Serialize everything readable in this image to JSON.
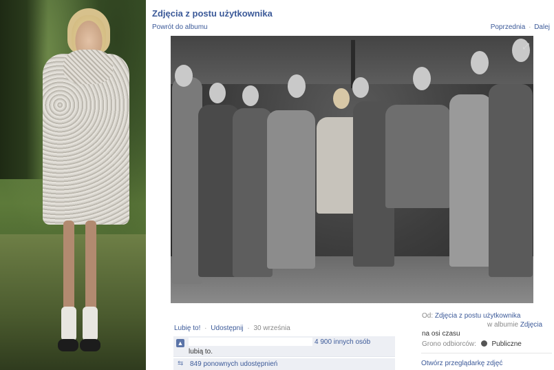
{
  "header": {
    "title": "Zdjęcia z postu użytkownika",
    "back_link": "Powrót do albumu",
    "prev_link": "Poprzednia",
    "next_link": "Dalej",
    "nav_separator": "·"
  },
  "actions": {
    "like": "Lubię to!",
    "share": "Udostępnij",
    "separator": "·",
    "date": "30 września"
  },
  "likes": {
    "count_text": "4 900 innych osób",
    "tail_text": "lubią to."
  },
  "shares": {
    "text": "849 ponownych udostępnień"
  },
  "meta": {
    "from_label": "Od:",
    "from_link": "Zdjęcia z postu użytkownika",
    "album_prefix": "w albumie",
    "album_link": "Zdjęcia",
    "album_tail": "na osi czasu",
    "audience_label": "Grono odbiorców:",
    "audience_value": "Publiczne",
    "viewer_link": "Otwórz przeglądarkę zdjęć"
  },
  "icons": {
    "expand": "expand-icon",
    "like": "thumbs-up-icon",
    "share": "share-icon",
    "audience": "globe-icon"
  },
  "colors": {
    "link": "#3b5998",
    "panel_bg": "#edeff4"
  }
}
